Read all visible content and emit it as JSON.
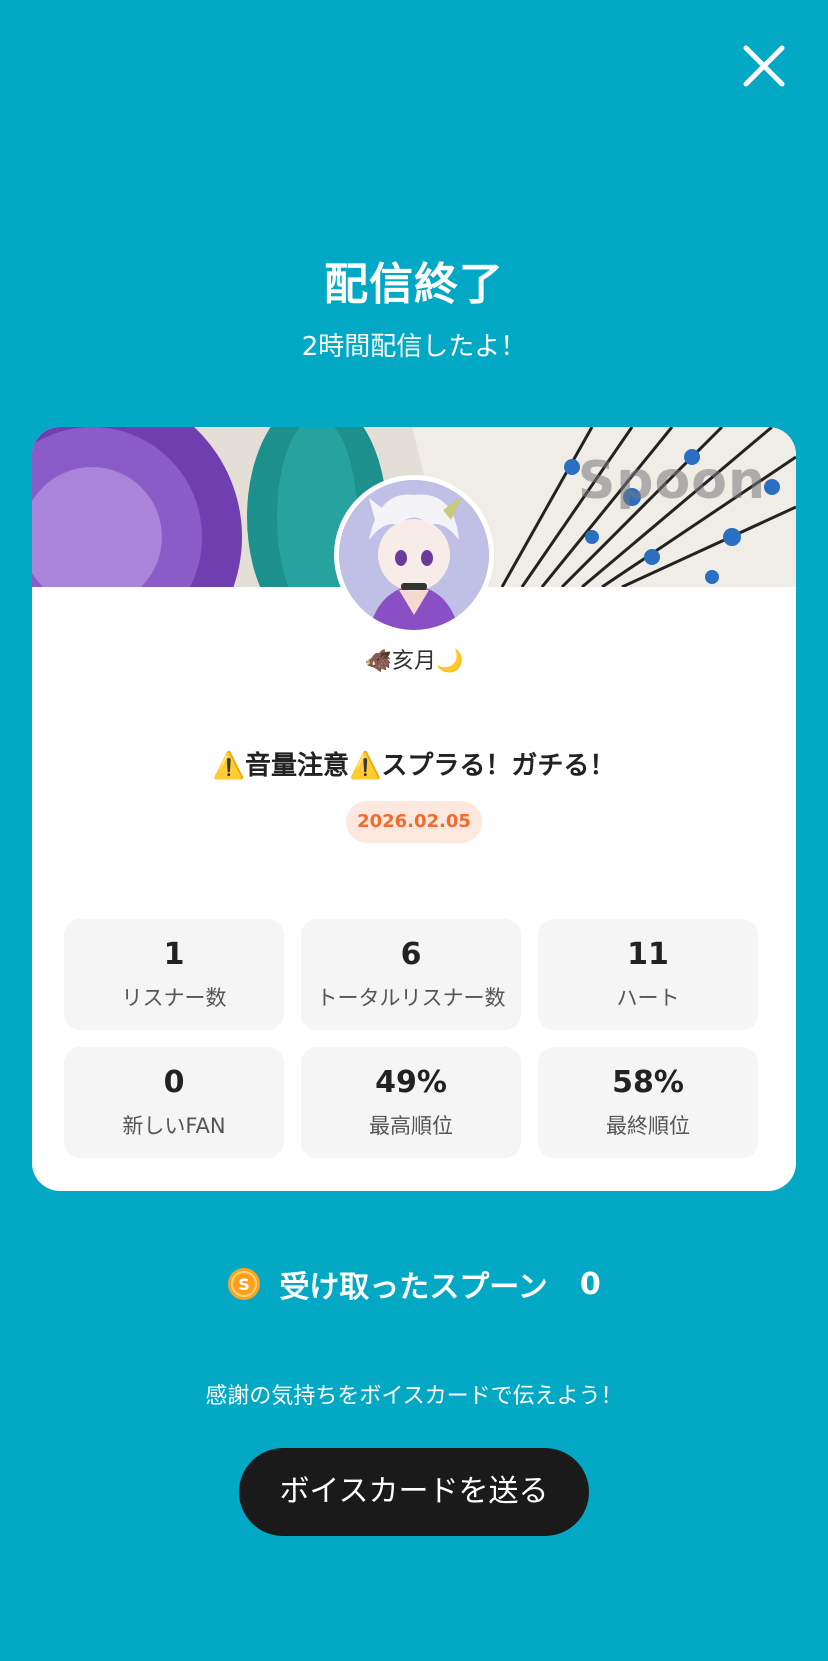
{
  "header": {
    "close_icon": "close-icon",
    "title": "配信終了",
    "subtitle": "2時間配信したよ！"
  },
  "card": {
    "banner_watermark": "Spoon",
    "username": "🐗亥月🌙",
    "show_title": "⚠️音量注意⚠️スプラる！ガチる！",
    "date": "2026.02.05",
    "stats": [
      {
        "value": "1",
        "label": "リスナー数"
      },
      {
        "value": "6",
        "label": "トータルリスナー数"
      },
      {
        "value": "11",
        "label": "ハート"
      },
      {
        "value": "0",
        "label": "新しいFAN"
      },
      {
        "value": "49%",
        "label": "最高順位"
      },
      {
        "value": "58%",
        "label": "最終順位"
      }
    ]
  },
  "spoons": {
    "label": "受け取ったスプーン",
    "count": "0",
    "icon": "spoon-coin-icon"
  },
  "footer": {
    "thanks_text": "感謝の気持ちをボイスカードで伝えよう！",
    "voice_card_button": "ボイスカードを送る"
  },
  "colors": {
    "background": "#03a9c4",
    "date_badge_bg": "#fde8df",
    "date_badge_text": "#f26a2e",
    "button_bg": "#1a1a1a"
  }
}
